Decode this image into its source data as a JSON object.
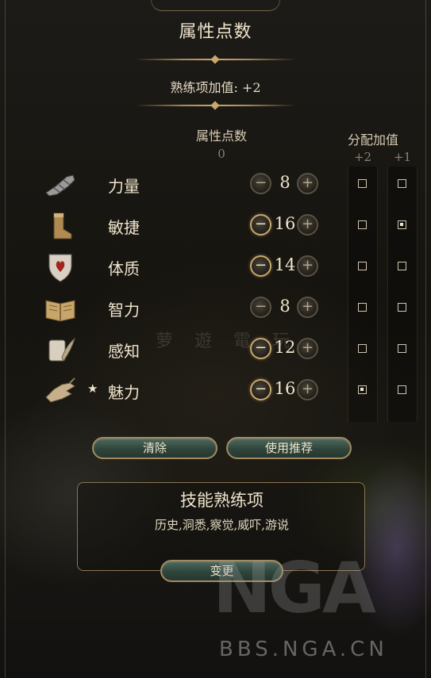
{
  "panel": {
    "title": "属性点数",
    "proficiency_bonus": "熟练项加值: +2"
  },
  "columns": {
    "points_header": "属性点数",
    "points_remaining": "0",
    "bonus_header": "分配加值",
    "bonus_plus2": "+2",
    "bonus_plus1": "+1"
  },
  "abilities": [
    {
      "name": "力量",
      "value": "8",
      "icon": "gauntlet-icon",
      "primary": false,
      "minus_enabled": false,
      "bonus_plus2": false,
      "bonus_plus1": false
    },
    {
      "name": "敏捷",
      "value": "16",
      "icon": "boot-icon",
      "primary": false,
      "minus_enabled": true,
      "bonus_plus2": false,
      "bonus_plus1": true
    },
    {
      "name": "体质",
      "value": "14",
      "icon": "heart-shield-icon",
      "primary": false,
      "minus_enabled": true,
      "bonus_plus2": false,
      "bonus_plus1": false
    },
    {
      "name": "智力",
      "value": "8",
      "icon": "book-icon",
      "primary": false,
      "minus_enabled": false,
      "bonus_plus2": false,
      "bonus_plus1": false
    },
    {
      "name": "感知",
      "value": "12",
      "icon": "scroll-feather-icon",
      "primary": false,
      "minus_enabled": true,
      "bonus_plus2": false,
      "bonus_plus1": false
    },
    {
      "name": "魅力",
      "value": "16",
      "icon": "hand-icon",
      "primary": true,
      "minus_enabled": true,
      "bonus_plus2": true,
      "bonus_plus1": false
    }
  ],
  "primary_marker": "★",
  "buttons": {
    "clear": "清除",
    "recommended": "使用推荐",
    "change": "变更"
  },
  "skills": {
    "title": "技能熟练项",
    "list": "历史,洞悉,察觉,威吓,游说"
  },
  "watermark": {
    "logo_text": "NGA",
    "site": "BBS.NGA.CN"
  },
  "colors": {
    "gold": "#c9a86e",
    "button_green": "#2f453c",
    "text": "#efe4cc"
  }
}
